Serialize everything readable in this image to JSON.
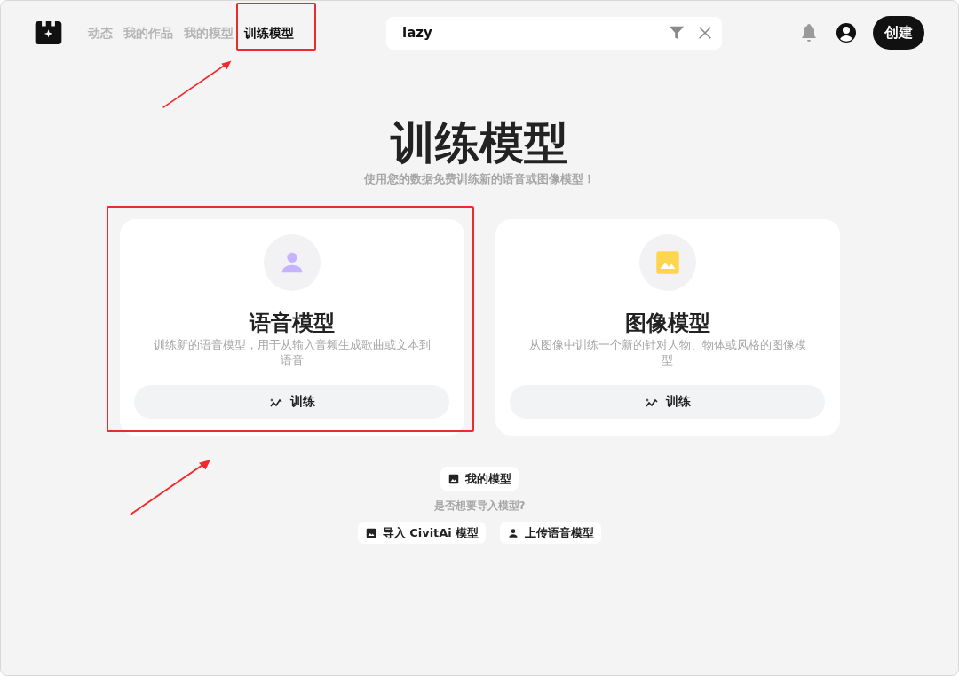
{
  "nav": {
    "tabs": [
      {
        "label": "动态",
        "selected": false,
        "highlighted": false
      },
      {
        "label": "我的作品",
        "selected": false,
        "highlighted": false
      },
      {
        "label": "我的模型",
        "selected": false,
        "highlighted": false
      },
      {
        "label": "训练模型",
        "selected": true,
        "highlighted": true
      }
    ]
  },
  "search": {
    "value": "lazy"
  },
  "create_button": "创建",
  "hero": {
    "title": "训练模型",
    "subtitle": "使用您的数据免费训练新的语音或图像模型！"
  },
  "cards": [
    {
      "kind": "voice",
      "title": "语音模型",
      "description": "训练新的语音模型，用于从输入音频生成歌曲或文本到语音",
      "button": "训练",
      "highlighted": true
    },
    {
      "kind": "image",
      "title": "图像模型",
      "description": "从图像中训练一个新的针对人物、物体或风格的图像模型",
      "button": "训练",
      "highlighted": false
    }
  ],
  "my_models_button": {
    "kind": "image",
    "label": "我的模型"
  },
  "import_prompt": "是否想要导入模型?",
  "import_buttons": [
    {
      "kind": "image",
      "label": "导入 CivitAi 模型"
    },
    {
      "kind": "person",
      "label": "上传语音模型"
    }
  ]
}
